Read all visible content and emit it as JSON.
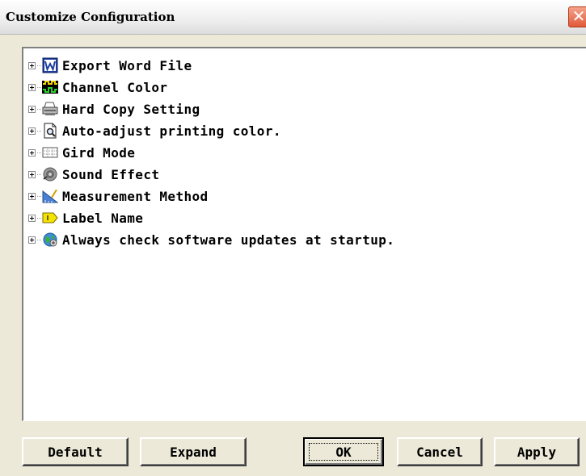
{
  "window": {
    "title": "Customize Configuration",
    "close_glyph": "✕"
  },
  "tree": {
    "items": [
      {
        "label": "Export Word File",
        "icon": "word-document-icon"
      },
      {
        "label": "Channel Color",
        "icon": "channel-waveform-icon"
      },
      {
        "label": "Hard Copy Setting",
        "icon": "printer-icon"
      },
      {
        "label": "Auto-adjust printing color.",
        "icon": "print-preview-icon"
      },
      {
        "label": "Gird Mode",
        "icon": "grid-icon"
      },
      {
        "label": "Sound Effect",
        "icon": "speaker-icon"
      },
      {
        "label": "Measurement Method",
        "icon": "measurement-icon"
      },
      {
        "label": "Label Name",
        "icon": "label-tag-icon"
      },
      {
        "label": "Always check software updates at startup.",
        "icon": "globe-update-icon"
      }
    ]
  },
  "buttons": {
    "default": "Default",
    "expand": "Expand",
    "ok": "OK",
    "cancel": "Cancel",
    "apply": "Apply"
  },
  "colors": {
    "dialog_bg": "#ece9d8",
    "close_button": "#e2593a",
    "word_icon": "#1f3f9f",
    "channel_icon": "#f2d000",
    "label_icon": "#f5e400"
  }
}
